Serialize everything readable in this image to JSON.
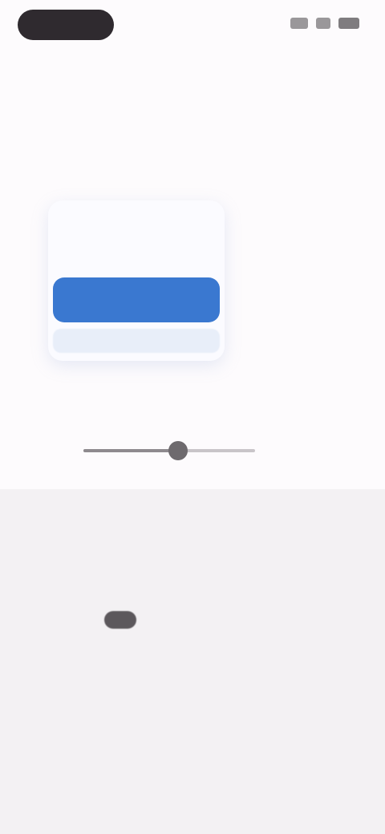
{
  "status_bar": {
    "time": ""
  },
  "header": {
    "subtitle": "",
    "title": ""
  },
  "card": {
    "label": "",
    "amount": "",
    "button_label": "",
    "footer_text": ""
  },
  "slider": {
    "value_fraction": 0.55,
    "caption": ""
  },
  "info": {
    "line1": "",
    "line2": "",
    "line3": ""
  },
  "bottom_link": {
    "label": ""
  },
  "colors": {
    "accent": "#3a78d0",
    "link": "#5a8fe0",
    "dark_pill": "#2f2a2f"
  }
}
